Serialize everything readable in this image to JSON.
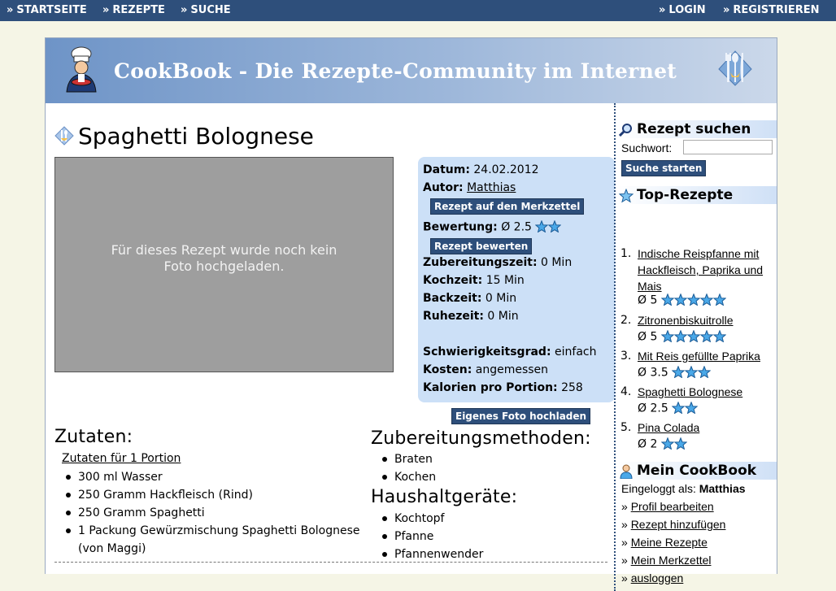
{
  "nav": {
    "left": [
      {
        "label": "STARTSEITE"
      },
      {
        "label": "REZEPTE"
      },
      {
        "label": "SUCHE"
      }
    ],
    "right": [
      {
        "label": "LOGIN"
      },
      {
        "label": "REGISTRIEREN"
      }
    ],
    "arrow": "»"
  },
  "banner": {
    "title": "CookBook - Die Rezepte-Community im Internet"
  },
  "recipe": {
    "title": "Spaghetti Bolognese",
    "photo_message": "Für dieses Rezept wurde noch kein Foto hochgeladen.",
    "info": {
      "date_label": "Datum:",
      "date": "24.02.2012",
      "author_label": "Autor:",
      "author": "Matthias",
      "bookmark_button": "Rezept auf den Merkzettel",
      "rating_label": "Bewertung:",
      "rating": "Ø 2.5",
      "rating_value": 2.5,
      "rate_button": "Rezept bewerten",
      "prep_label": "Zubereitungszeit:",
      "prep": "0 Min",
      "cook_label": "Kochzeit:",
      "cook": "15 Min",
      "bake_label": "Backzeit:",
      "bake": "0 Min",
      "rest_label": "Ruhezeit:",
      "rest": "0 Min",
      "difficulty_label": "Schwierigkeitsgrad:",
      "difficulty": "einfach",
      "cost_label": "Kosten:",
      "cost": "angemessen",
      "calories_label": "Kalorien pro Portion:",
      "calories": "258"
    },
    "upload_button": "Eigenes Foto hochladen",
    "ingredients": {
      "heading": "Zutaten:",
      "portion_link": "Zutaten für 1 Portion",
      "items": [
        "300 ml Wasser",
        "250 Gramm Hackfleisch (Rind)",
        "250 Gramm Spaghetti",
        "1 Packung Gewürzmischung Spaghetti Bolognese",
        "(von Maggi)"
      ]
    },
    "methods": {
      "heading": "Zubereitungsmethoden:",
      "items": [
        "Braten",
        "Kochen"
      ]
    },
    "appliances": {
      "heading": "Haushaltgeräte:",
      "items": [
        "Kochtopf",
        "Pfanne",
        "Pfannenwender"
      ]
    }
  },
  "sidebar": {
    "search": {
      "heading": "Rezept suchen",
      "label": "Suchwort:",
      "value": "",
      "button": "Suche starten"
    },
    "top": {
      "heading": "Top-Rezepte",
      "items": [
        {
          "num": "1.",
          "name": "Indische Reispfanne mit Hackfleisch, Paprika und Mais",
          "rating": "Ø 5",
          "stars": 5
        },
        {
          "num": "2.",
          "name": "Zitronenbiskuitrolle",
          "rating": "Ø 5",
          "stars": 5
        },
        {
          "num": "3.",
          "name": "Mit Reis gefüllte Paprika",
          "rating": "Ø 3.5",
          "stars": 3
        },
        {
          "num": "4.",
          "name": "Spaghetti Bolognese",
          "rating": "Ø 2.5",
          "stars": 2
        },
        {
          "num": "5.",
          "name": "Pina Colada",
          "rating": "Ø 2",
          "stars": 2
        }
      ]
    },
    "mycookbook": {
      "heading": "Mein CookBook",
      "logged_label": "Eingeloggt als:",
      "user": "Matthias",
      "links": [
        "Profil bearbeiten",
        "Rezept hinzufügen",
        "Meine Rezepte",
        "Mein Merkzettel",
        "ausloggen"
      ]
    }
  },
  "colors": {
    "nav": "#2e4f7b",
    "accent": "#cce0f7",
    "star": "#4aa8e8"
  }
}
